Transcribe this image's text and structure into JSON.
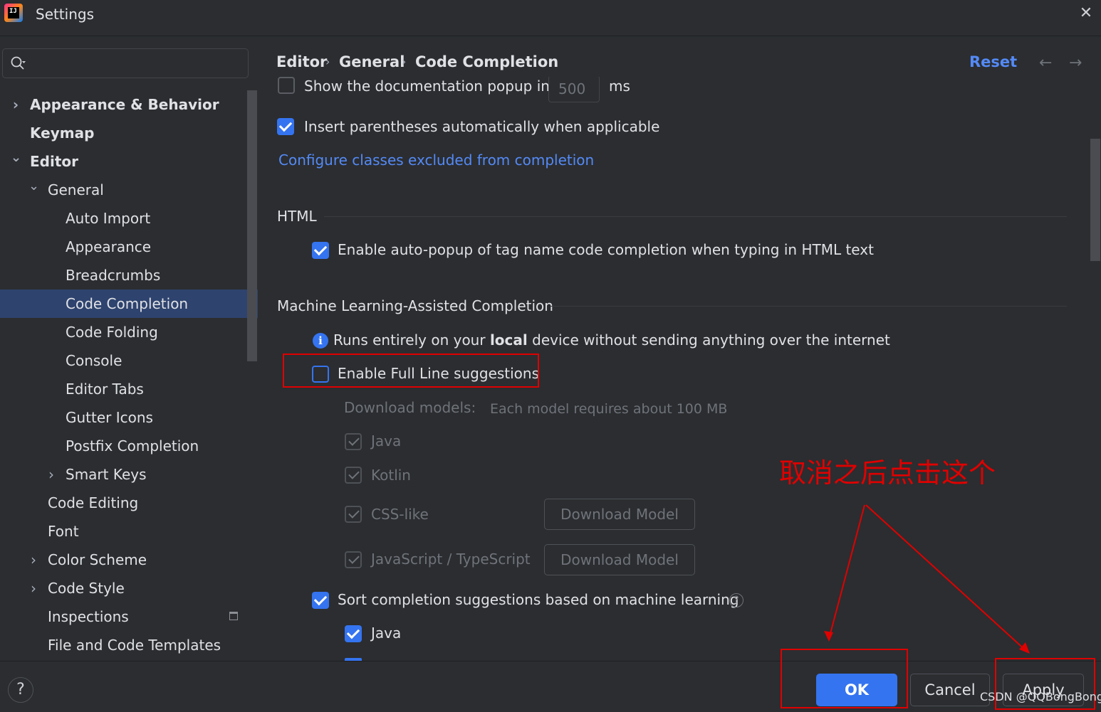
{
  "window": {
    "title": "Settings",
    "app_icon_text": "IJ"
  },
  "search": {
    "placeholder": ""
  },
  "tree": [
    {
      "label": "Appearance & Behavior",
      "expander": "collapsed",
      "bold": true
    },
    {
      "label": "Keymap",
      "bold": true
    },
    {
      "label": "Editor",
      "expander": "expanded",
      "bold": true
    },
    {
      "label": "General",
      "expander": "expanded"
    },
    {
      "label": "Auto Import"
    },
    {
      "label": "Appearance"
    },
    {
      "label": "Breadcrumbs"
    },
    {
      "label": "Code Completion",
      "selected": true
    },
    {
      "label": "Code Folding"
    },
    {
      "label": "Console"
    },
    {
      "label": "Editor Tabs"
    },
    {
      "label": "Gutter Icons"
    },
    {
      "label": "Postfix Completion"
    },
    {
      "label": "Smart Keys",
      "expander": "collapsed"
    },
    {
      "label": "Code Editing"
    },
    {
      "label": "Font"
    },
    {
      "label": "Color Scheme",
      "expander": "collapsed"
    },
    {
      "label": "Code Style",
      "expander": "collapsed"
    },
    {
      "label": "Inspections"
    },
    {
      "label": "File and Code Templates"
    }
  ],
  "breadcrumb": [
    "Editor",
    "General",
    "Code Completion"
  ],
  "header": {
    "reset": "Reset"
  },
  "content": {
    "doc_popup": {
      "label": "Show the documentation popup in",
      "value": "500",
      "unit": "ms",
      "checked": false
    },
    "insert_parens": {
      "label": "Insert parentheses automatically when applicable",
      "checked": true
    },
    "configure_link": "Configure classes excluded from completion",
    "html_section": "HTML",
    "html_autopopup": {
      "label": "Enable auto-popup of tag name code completion when typing in HTML text",
      "checked": true
    },
    "ml_section": "Machine Learning-Assisted Completion",
    "ml_info": {
      "pre": "Runs entirely on your ",
      "bold": "local",
      "post": " device without sending anything over the internet"
    },
    "full_line": {
      "label": "Enable Full Line suggestions",
      "checked": false
    },
    "download_models": {
      "label": "Download models:",
      "note": "Each model requires about 100 MB"
    },
    "models": [
      {
        "name": "Java",
        "checked": true
      },
      {
        "name": "Kotlin",
        "checked": true
      },
      {
        "name": "CSS-like",
        "checked": true,
        "button": "Download Model"
      },
      {
        "name": "JavaScript / TypeScript",
        "checked": true,
        "button": "Download Model"
      }
    ],
    "sort_ml": {
      "label": "Sort completion suggestions based on machine learning",
      "checked": true
    },
    "sort_java": {
      "label": "Java",
      "checked": true
    }
  },
  "footer": {
    "help": "?",
    "ok": "OK",
    "cancel": "Cancel",
    "apply": "Apply"
  },
  "annotation": {
    "text": "取消之后点击这个",
    "color": "#e00000"
  },
  "watermark": "CSDN @QQBongBong",
  "colors": {
    "accent": "#3574f0",
    "link": "#548af7",
    "selection": "#2e436e",
    "background": "#2b2d30",
    "annotation": "#e00000"
  }
}
